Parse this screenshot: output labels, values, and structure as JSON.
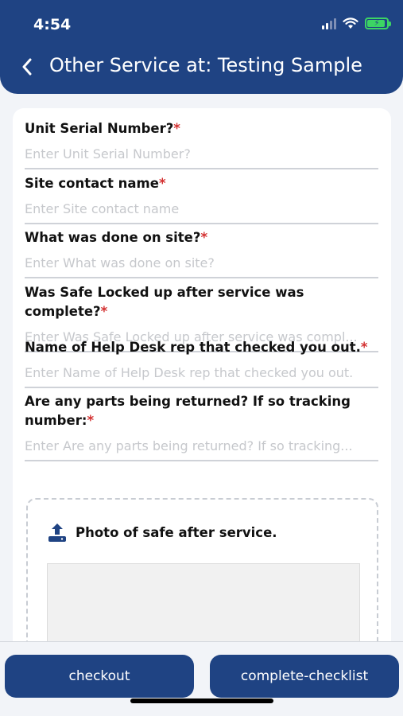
{
  "status_bar": {
    "time": "4:54",
    "icons": [
      "signal-icon",
      "wifi-icon",
      "battery-charging-icon"
    ]
  },
  "header": {
    "title": "Other Service at: Testing Sample",
    "back_icon": "chevron-left-icon"
  },
  "form": {
    "required_marker": "*",
    "fields": [
      {
        "label": "Unit Serial Number?",
        "placeholder": "Enter Unit Serial Number?",
        "value": ""
      },
      {
        "label": "Site contact name",
        "placeholder": "Enter Site contact name",
        "value": ""
      },
      {
        "label": "What was done on site?",
        "placeholder": "Enter What was done on site?",
        "value": ""
      },
      {
        "label": "Was Safe Locked up after service was complete?",
        "placeholder": "Enter Was Safe Locked up after service was compl...",
        "value": ""
      },
      {
        "label": "Name of Help Desk rep that checked you out.",
        "placeholder": "Enter Name of Help Desk rep that checked you out.",
        "value": ""
      },
      {
        "label": "Are any parts being returned? If so tracking number:",
        "placeholder": "Enter Are any parts being returned? If so tracking...",
        "value": ""
      }
    ],
    "upload": {
      "label": "Photo of safe after service.",
      "icon": "upload-icon"
    }
  },
  "footer": {
    "checkout_label": "checkout",
    "complete_label": "complete-checklist"
  },
  "colors": {
    "primary": "#1f4383",
    "required": "#d32f2f",
    "battery": "#3cd464"
  }
}
